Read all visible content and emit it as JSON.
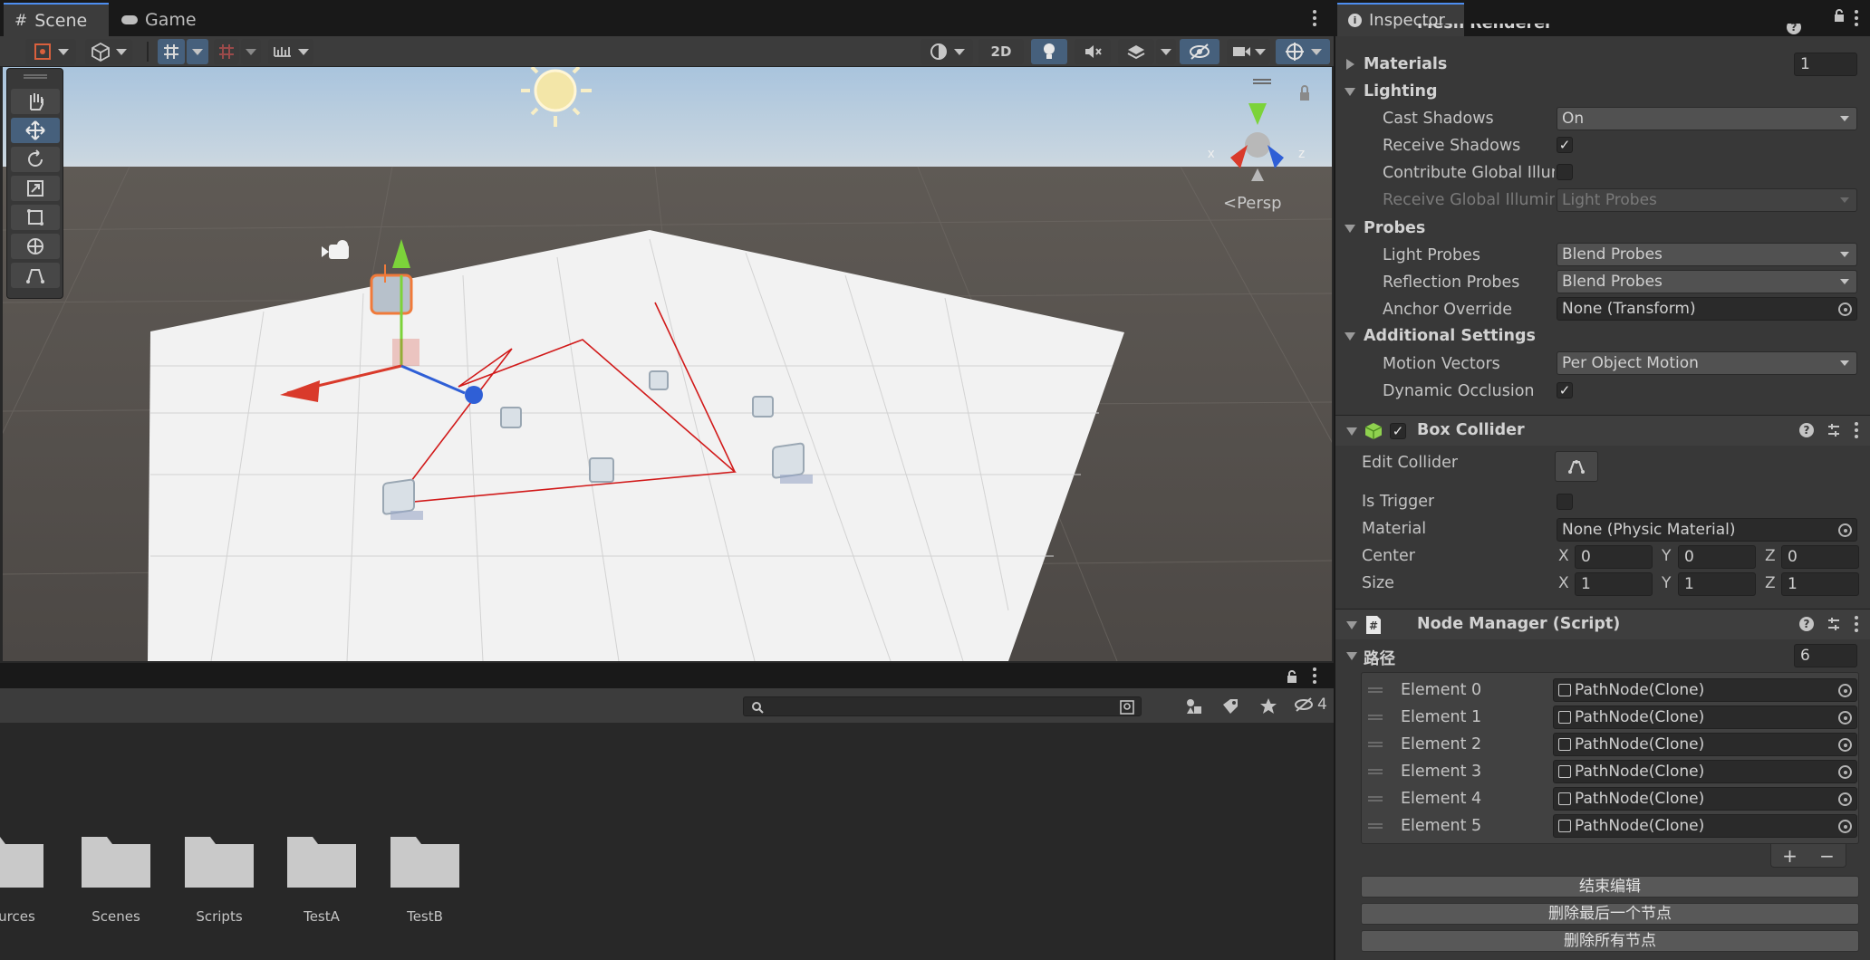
{
  "scene_tabs": {
    "scene": "Scene",
    "game": "Game"
  },
  "scene_toolbar": {
    "mode_2d": "2D"
  },
  "viewport": {
    "projection_label": "Persp",
    "gizmo_x": "x",
    "gizmo_z": "z"
  },
  "project": {
    "filter_count": "4",
    "folders": [
      "sources",
      "Scenes",
      "Scripts",
      "TestA",
      "TestB"
    ]
  },
  "inspector": {
    "tab": "Inspector",
    "mesh_renderer": {
      "title": "Mesh Renderer",
      "materials_label": "Materials",
      "materials_count": "1",
      "lighting_label": "Lighting",
      "cast_shadows_label": "Cast Shadows",
      "cast_shadows_value": "On",
      "receive_shadows_label": "Receive Shadows",
      "receive_shadows": true,
      "contribute_gi_label": "Contribute Global Illumination",
      "contribute_gi": false,
      "receive_gi_label": "Receive Global Illumination",
      "receive_gi_value": "Light Probes",
      "probes_label": "Probes",
      "light_probes_label": "Light Probes",
      "light_probes_value": "Blend Probes",
      "reflection_probes_label": "Reflection Probes",
      "reflection_probes_value": "Blend Probes",
      "anchor_override_label": "Anchor Override",
      "anchor_override_value": "None (Transform)",
      "additional_label": "Additional Settings",
      "motion_vectors_label": "Motion Vectors",
      "motion_vectors_value": "Per Object Motion",
      "dynamic_occlusion_label": "Dynamic Occlusion",
      "dynamic_occlusion": true
    },
    "box_collider": {
      "title": "Box Collider",
      "enabled": true,
      "edit_collider_label": "Edit Collider",
      "is_trigger_label": "Is Trigger",
      "is_trigger": false,
      "material_label": "Material",
      "material_value": "None (Physic Material)",
      "center_label": "Center",
      "center": {
        "x": "0",
        "y": "0",
        "z": "0"
      },
      "size_label": "Size",
      "size": {
        "x": "1",
        "y": "1",
        "z": "1"
      }
    },
    "node_manager": {
      "title": "Node Manager (Script)",
      "path_label": "路径",
      "path_count": "6",
      "elements": [
        {
          "label": "Element 0",
          "value": "PathNode(Clone)"
        },
        {
          "label": "Element 1",
          "value": "PathNode(Clone)"
        },
        {
          "label": "Element 2",
          "value": "PathNode(Clone)"
        },
        {
          "label": "Element 3",
          "value": "PathNode(Clone)"
        },
        {
          "label": "Element 4",
          "value": "PathNode(Clone)"
        },
        {
          "label": "Element 5",
          "value": "PathNode(Clone)"
        }
      ],
      "add": "+",
      "remove": "−",
      "buttons": {
        "end_edit": "结束编辑",
        "delete_last": "删除最后一个节点",
        "delete_all": "删除所有节点"
      }
    }
  },
  "colors": {
    "accent": "#46607c",
    "path_line": "#d11a1a",
    "gizmo_x": "#d93a2b",
    "gizmo_y": "#7cd33a",
    "gizmo_z": "#2f5fd6"
  }
}
